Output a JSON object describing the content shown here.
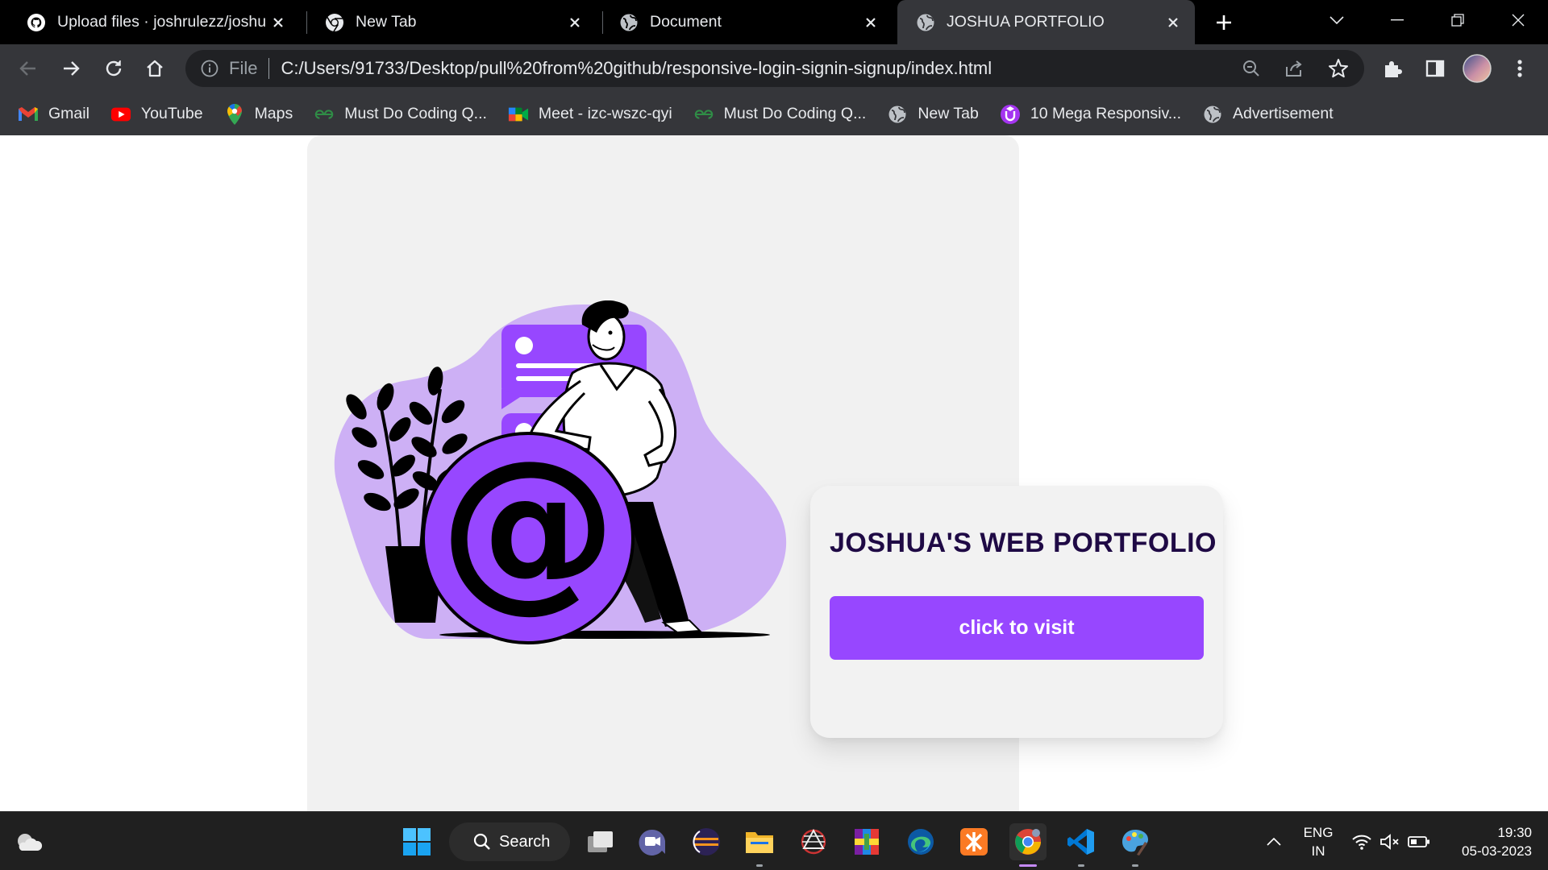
{
  "browser": {
    "tabs": [
      {
        "title": "Upload files · joshrulezz/joshua",
        "icon": "github-icon",
        "active": false
      },
      {
        "title": "New Tab",
        "icon": "chrome-icon",
        "active": false
      },
      {
        "title": "Document",
        "icon": "globe-icon",
        "active": false
      },
      {
        "title": "JOSHUA PORTFOLIO",
        "icon": "globe-icon",
        "active": true
      }
    ],
    "omnibox": {
      "scheme": "File",
      "url": "C:/Users/91733/Desktop/pull%20from%20github/responsive-login-signin-signup/index.html"
    },
    "bookmarks": [
      {
        "label": "Gmail",
        "icon": "gmail-icon"
      },
      {
        "label": "YouTube",
        "icon": "youtube-icon"
      },
      {
        "label": "Maps",
        "icon": "maps-icon"
      },
      {
        "label": "Must Do Coding Q...",
        "icon": "gfg-icon"
      },
      {
        "label": "Meet - izc-wszc-qyi",
        "icon": "meet-icon"
      },
      {
        "label": "Must Do Coding Q...",
        "icon": "gfg-icon"
      },
      {
        "label": "New Tab",
        "icon": "globe-icon"
      },
      {
        "label": "10 Mega Responsiv...",
        "icon": "purple-u-icon"
      },
      {
        "label": "Advertisement",
        "icon": "globe-icon"
      }
    ]
  },
  "page": {
    "card_title": "JOSHUA'S WEB PORTFOLIO",
    "button_label": "click to visit",
    "at_symbol": "@"
  },
  "taskbar": {
    "search_label": "Search",
    "lang_line1": "ENG",
    "lang_line2": "IN",
    "time": "19:30",
    "date": "05-03-2023"
  },
  "colors": {
    "accent": "#9747ff",
    "blob": "#cdb0f5",
    "card_title": "#1f0a45",
    "panel": "#f1f1f1"
  }
}
